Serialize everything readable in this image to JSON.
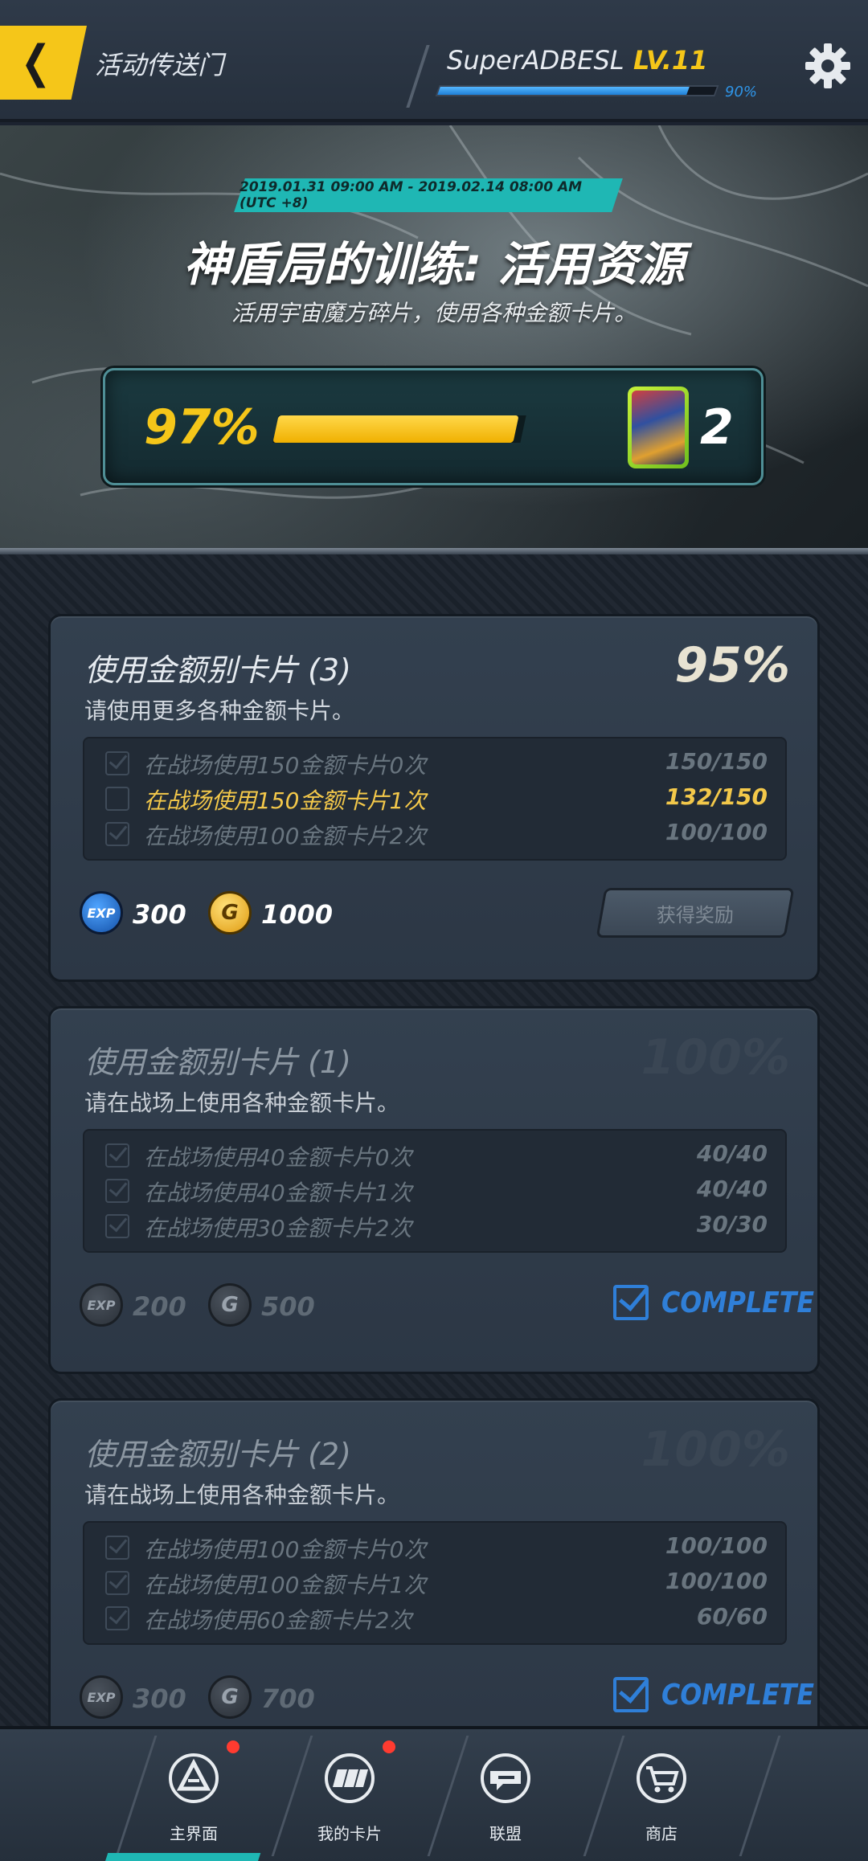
{
  "header": {
    "back_icon": "back-chevron-icon",
    "title": "活动传送门",
    "username": "SuperADBESL",
    "level": "LV.11",
    "xp_percent_label": "90%",
    "xp_fraction": 0.9,
    "settings_icon": "gear-icon"
  },
  "banner": {
    "date_range": "2019.01.31 09:00 AM - 2019.02.14 08:00 AM (UTC +8)",
    "title": "神盾局的训练: 活用资源",
    "subtitle": "活用宇宙魔方碎片，使用各种金额卡片。",
    "progress_label": "97%",
    "progress_fraction": 0.97,
    "reward_icon": "card-pack-icon",
    "reward_count": "2"
  },
  "missions": [
    {
      "title": "使用金额别卡片 (3)",
      "desc": "请使用更多各种金额卡片。",
      "percent": "95%",
      "tasks": [
        {
          "text": "在战场使用150金额卡片0次",
          "value": "150/150",
          "done": true
        },
        {
          "text": "在战场使用150金额卡片1次",
          "value": "132/150",
          "done": false
        },
        {
          "text": "在战场使用100金额卡片2次",
          "value": "100/100",
          "done": true
        }
      ],
      "exp_icon": "exp-coin-icon",
      "exp_label": "EXP",
      "exp": "300",
      "gold_icon": "gold-coin-icon",
      "gold_label": "G",
      "gold": "1000",
      "claim_label": "获得奖励"
    },
    {
      "title": "使用金额别卡片 (1)",
      "desc": "请在战场上使用各种金额卡片。",
      "percent": "100%",
      "tasks": [
        {
          "text": "在战场使用40金额卡片0次",
          "value": "40/40",
          "done": true
        },
        {
          "text": "在战场使用40金额卡片1次",
          "value": "40/40",
          "done": true
        },
        {
          "text": "在战场使用30金额卡片2次",
          "value": "30/30",
          "done": true
        }
      ],
      "exp_label": "EXP",
      "exp": "200",
      "gold_label": "G",
      "gold": "500",
      "complete_label": "COMPLETE"
    },
    {
      "title": "使用金额别卡片 (2)",
      "desc": "请在战场上使用各种金额卡片。",
      "percent": "100%",
      "tasks": [
        {
          "text": "在战场使用100金额卡片0次",
          "value": "100/100",
          "done": true
        },
        {
          "text": "在战场使用100金额卡片1次",
          "value": "100/100",
          "done": true
        },
        {
          "text": "在战场使用60金额卡片2次",
          "value": "60/60",
          "done": true
        }
      ],
      "exp_label": "EXP",
      "exp": "300",
      "gold_label": "G",
      "gold": "700",
      "complete_label": "COMPLETE"
    }
  ],
  "nav": [
    {
      "label": "主界面",
      "icon": "home-icon",
      "badge": true,
      "active": true
    },
    {
      "label": "我的卡片",
      "icon": "cards-icon",
      "badge": true,
      "active": false
    },
    {
      "label": "联盟",
      "icon": "alliance-icon",
      "badge": false,
      "active": false
    },
    {
      "label": "商店",
      "icon": "shop-cart-icon",
      "badge": false,
      "active": false
    }
  ],
  "colors": {
    "accent_yellow": "#f5c619",
    "accent_teal": "#1fb7b4",
    "complete_blue": "#2f7fd8",
    "badge_red": "#ff3b30"
  }
}
